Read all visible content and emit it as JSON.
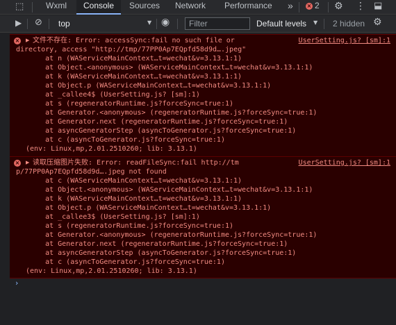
{
  "tabs": {
    "wxml": "Wxml",
    "console": "Console",
    "sources": "Sources",
    "network": "Network",
    "performance": "Performance",
    "more": "»",
    "error_count": "2"
  },
  "toolbar": {
    "context": "top",
    "filter_placeholder": "Filter",
    "levels": "Default levels",
    "hidden": "2 hidden"
  },
  "errors": [
    {
      "source": "UserSetting.js? [sm]:1",
      "lines": [
        "文件不存在: Error: accessSync:fail no such file or",
        "directory, access \"http://tmp/77PP0Ap7EQpfd58d9d….jpeg\"",
        "    at n (WAServiceMainContext…t=wechat&v=3.13.1:1)",
        "    at Object.<anonymous> (WAServiceMainContext…t=wechat&v=3.13.1:1)",
        "    at k (WAServiceMainContext…t=wechat&v=3.13.1:1)",
        "    at Object.p (WAServiceMainContext…t=wechat&v=3.13.1:1)",
        "    at _callee4$ (UserSetting.js? [sm]:1)",
        "    at s (regeneratorRuntime.js?forceSync=true:1)",
        "    at Generator.<anonymous> (regeneratorRuntime.js?forceSync=true:1)",
        "    at Generator.next (regeneratorRuntime.js?forceSync=true:1)",
        "    at asyncGeneratorStep (asyncToGenerator.js?forceSync=true:1)",
        "    at c (asyncToGenerator.js?forceSync=true:1)",
        "(env: Linux,mp,2.01.2510260; lib: 3.13.1)"
      ]
    },
    {
      "source": "UserSetting.js? [sm]:1",
      "lines": [
        "读取压缩图片失败: Error: readFileSync:fail http://tm",
        "p/77PP0Ap7EQpfd58d9d….jpeg not found",
        "    at c (WAServiceMainContext…t=wechat&v=3.13.1:1)",
        "    at Object.<anonymous> (WAServiceMainContext…t=wechat&v=3.13.1:1)",
        "    at k (WAServiceMainContext…t=wechat&v=3.13.1:1)",
        "    at Object.p (WAServiceMainContext…t=wechat&v=3.13.1:1)",
        "    at _callee3$ (UserSetting.js? [sm]:1)",
        "    at s (regeneratorRuntime.js?forceSync=true:1)",
        "    at Generator.<anonymous> (regeneratorRuntime.js?forceSync=true:1)",
        "    at Generator.next (regeneratorRuntime.js?forceSync=true:1)",
        "    at asyncGeneratorStep (asyncToGenerator.js?forceSync=true:1)",
        "    at c (asyncToGenerator.js?forceSync=true:1)",
        "(env: Linux,mp,2.01.2510260; lib: 3.13.1)"
      ]
    }
  ],
  "prompt_symbol": "›",
  "colors": {
    "error_text": "#f28b82",
    "error_bg": "#2a0000",
    "accent": "#8ab4f8"
  }
}
